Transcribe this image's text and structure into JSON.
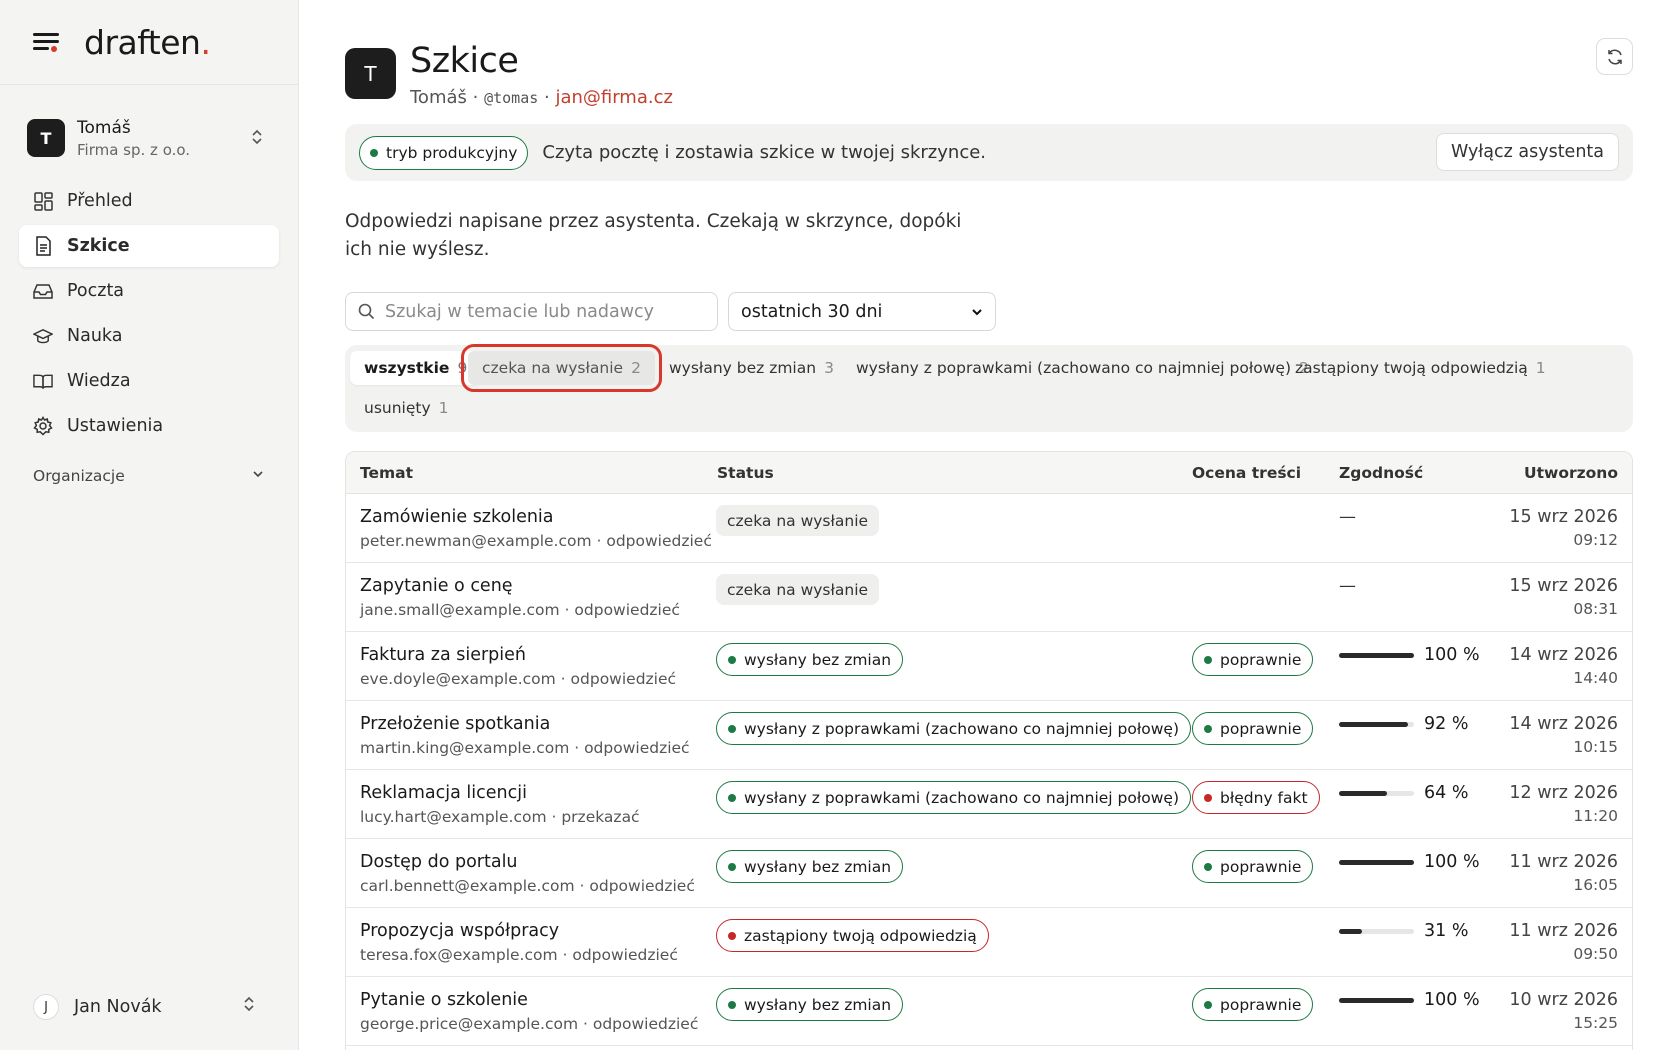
{
  "brand": {
    "name": "draften",
    "dot": "."
  },
  "org": {
    "initial": "T",
    "name": "Tomáš",
    "company": "Firma sp. z o.o."
  },
  "nav": [
    {
      "label": "Přehled",
      "icon": "dashboard-icon",
      "active": false
    },
    {
      "label": "Szkice",
      "icon": "document-icon",
      "active": true
    },
    {
      "label": "Poczta",
      "icon": "inbox-icon",
      "active": false
    },
    {
      "label": "Nauka",
      "icon": "graduation-cap-icon",
      "active": false
    },
    {
      "label": "Wiedza",
      "icon": "book-icon",
      "active": false
    },
    {
      "label": "Ustawienia",
      "icon": "gear-icon",
      "active": false
    }
  ],
  "organizations_label": "Organizacje",
  "user": {
    "initial": "J",
    "name": "Jan Novák"
  },
  "header": {
    "initial": "T",
    "title": "Szkice",
    "name": "Tomáš",
    "handle": "@tomas",
    "email": "jan@firma.cz"
  },
  "banner": {
    "mode": "tryb produkcyjny",
    "text": "Czyta pocztę i zostawia szkice w twojej skrzynce.",
    "button": "Wyłącz asystenta"
  },
  "intro": "Odpowiedzi napisane przez asystenta. Czekają w skrzynce, dopóki ich nie wyślesz.",
  "search": {
    "placeholder": "Szukaj w temacie lub nadawcy"
  },
  "period": {
    "selected": "ostatnich 30 dni"
  },
  "filters": [
    {
      "label": "wszystkie",
      "count": "9"
    },
    {
      "label": "czeka na wysłanie",
      "count": "2"
    },
    {
      "label": "wysłany bez zmian",
      "count": "3"
    },
    {
      "label": "wysłany z poprawkami (zachowano co najmniej połowę)",
      "count": "2"
    },
    {
      "label": "zastąpiony twoją odpowiedzią",
      "count": "1"
    },
    {
      "label": "usunięty",
      "count": "1"
    }
  ],
  "table": {
    "columns": {
      "subject": "Temat",
      "status": "Status",
      "quality": "Ocena treści",
      "agreement": "Zgodność",
      "created": "Utworzono"
    },
    "rows": [
      {
        "subject": "Zamówienie szkolenia",
        "sender": "peter.newman@example.com · odpowiedzieć",
        "status": "czeka na wysłanie",
        "status_style": "grey",
        "quality": "",
        "quality_style": "",
        "agreement": "—",
        "agreement_value": null,
        "date": "15 wrz 2026",
        "time": "09:12"
      },
      {
        "subject": "Zapytanie o cenę",
        "sender": "jane.small@example.com · odpowiedzieć",
        "status": "czeka na wysłanie",
        "status_style": "grey",
        "quality": "",
        "quality_style": "",
        "agreement": "—",
        "agreement_value": null,
        "date": "15 wrz 2026",
        "time": "08:31"
      },
      {
        "subject": "Faktura za sierpień",
        "sender": "eve.doyle@example.com · odpowiedzieć",
        "status": "wysłany bez zmian",
        "status_style": "green",
        "quality": "poprawnie",
        "quality_style": "green",
        "agreement": "100 %",
        "agreement_value": 100,
        "date": "14 wrz 2026",
        "time": "14:40"
      },
      {
        "subject": "Przełożenie spotkania",
        "sender": "martin.king@example.com · odpowiedzieć",
        "status": "wysłany z poprawkami (zachowano co najmniej połowę)",
        "status_style": "green",
        "quality": "poprawnie",
        "quality_style": "green",
        "agreement": "92 %",
        "agreement_value": 92,
        "date": "14 wrz 2026",
        "time": "10:15"
      },
      {
        "subject": "Reklamacja licencji",
        "sender": "lucy.hart@example.com · przekazać",
        "status": "wysłany z poprawkami (zachowano co najmniej połowę)",
        "status_style": "green",
        "quality": "błędny fakt",
        "quality_style": "red",
        "agreement": "64 %",
        "agreement_value": 64,
        "date": "12 wrz 2026",
        "time": "11:20"
      },
      {
        "subject": "Dostęp do portalu",
        "sender": "carl.bennett@example.com · odpowiedzieć",
        "status": "wysłany bez zmian",
        "status_style": "green",
        "quality": "poprawnie",
        "quality_style": "green",
        "agreement": "100 %",
        "agreement_value": 100,
        "date": "11 wrz 2026",
        "time": "16:05"
      },
      {
        "subject": "Propozycja współpracy",
        "sender": "teresa.fox@example.com · odpowiedzieć",
        "status": "zastąpiony twoją odpowiedzią",
        "status_style": "red",
        "quality": "",
        "quality_style": "",
        "agreement": "31 %",
        "agreement_value": 31,
        "date": "11 wrz 2026",
        "time": "09:50"
      },
      {
        "subject": "Pytanie o szkolenie",
        "sender": "george.price@example.com · odpowiedzieć",
        "status": "wysłany bez zmian",
        "status_style": "green",
        "quality": "poprawnie",
        "quality_style": "green",
        "agreement": "100 %",
        "agreement_value": 100,
        "date": "10 wrz 2026",
        "time": "15:25"
      }
    ]
  },
  "colors": {
    "accent_red": "#d63a2b",
    "status_green": "#1e7a45",
    "status_red": "#c62828",
    "email_link": "#c2402e"
  }
}
